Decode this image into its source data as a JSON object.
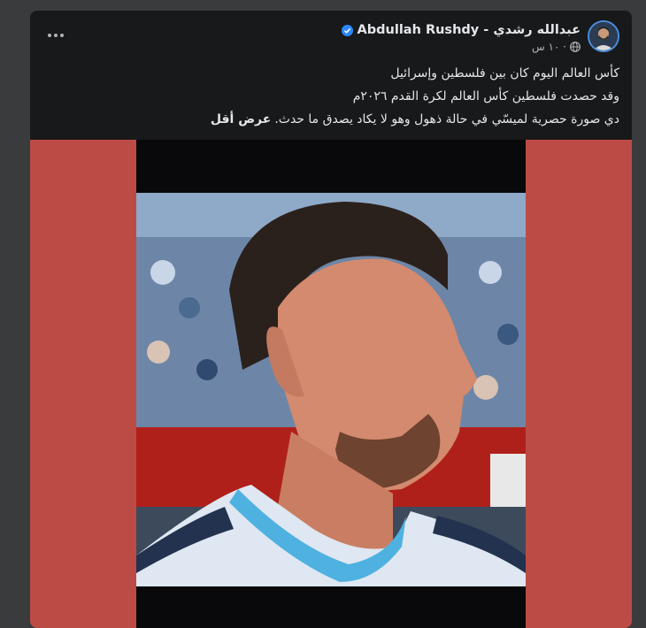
{
  "post": {
    "author_name": "Abdullah Rushdy - عبدالله رشدي",
    "verified_icon": "verified-badge-icon",
    "time": "١٠ س ·",
    "privacy_icon": "globe-icon",
    "more_icon": "more-options-icon",
    "lines": [
      "كأس العالم اليوم كان بين فلسطين وإسرائيل",
      "وقد حصدت فلسطين كأس العالم لكرة القدم ٢٠٢٦م",
      "دي صورة حصرية لميسّي في حالة ذهول وهو لا يكاد يصدق ما حدث."
    ],
    "see_less": "عرض أقل"
  },
  "colors": {
    "card_background": "#18191a",
    "page_background": "#3a3b3c",
    "media_background": "#bd4b45",
    "verified_blue": "#2d88ff"
  }
}
